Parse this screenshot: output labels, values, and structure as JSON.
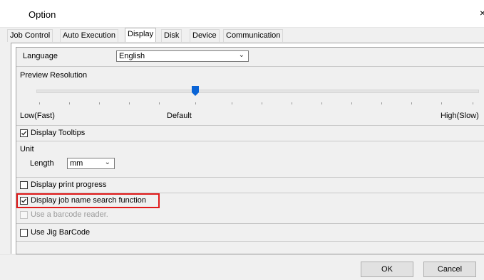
{
  "window": {
    "title": "Option",
    "close": "×"
  },
  "tabs": [
    {
      "label": "Job Control"
    },
    {
      "label": "Auto Execution"
    },
    {
      "label": "Display"
    },
    {
      "label": "Disk"
    },
    {
      "label": "Device"
    },
    {
      "label": "Communication"
    }
  ],
  "active_tab": "Display",
  "language": {
    "label": "Language",
    "value": "English"
  },
  "preview": {
    "title": "Preview Resolution",
    "low": "Low(Fast)",
    "default": "Default",
    "high": "High(Slow)",
    "level_fraction": 0.37
  },
  "tooltips": {
    "label": "Display Tooltips",
    "checked": true
  },
  "unit": {
    "title": "Unit",
    "length_label": "Length",
    "length_value": "mm"
  },
  "print_progress": {
    "label": "Display print progress",
    "checked": false
  },
  "job_search": {
    "label": "Display job name search function",
    "checked": true
  },
  "barcode_reader": {
    "label": "Use a barcode reader.",
    "checked": false,
    "enabled": false
  },
  "jig_barcode": {
    "label": "Use Jig BarCode",
    "checked": false
  },
  "buttons": {
    "ok": "OK",
    "cancel": "Cancel"
  },
  "colors": {
    "accent": "#0a64d6",
    "highlight": "#e01919"
  }
}
